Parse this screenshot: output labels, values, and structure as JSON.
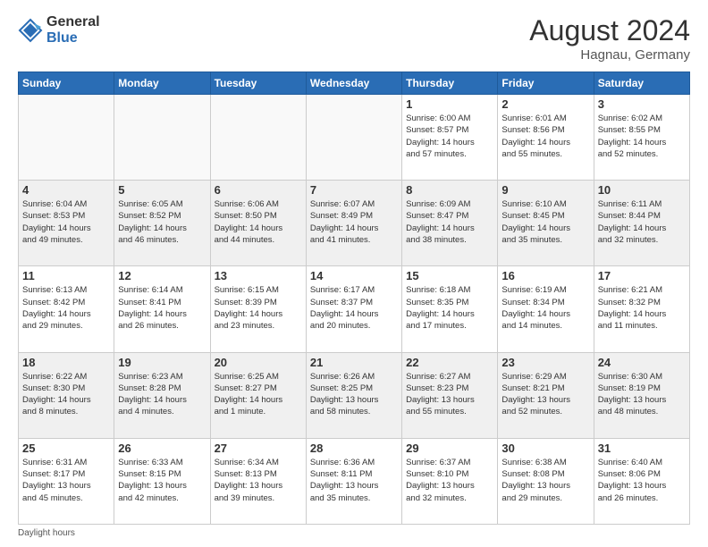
{
  "logo": {
    "general": "General",
    "blue": "Blue"
  },
  "header": {
    "month": "August 2024",
    "location": "Hagnau, Germany"
  },
  "days_of_week": [
    "Sunday",
    "Monday",
    "Tuesday",
    "Wednesday",
    "Thursday",
    "Friday",
    "Saturday"
  ],
  "footer": {
    "note": "Daylight hours"
  },
  "weeks": [
    {
      "days": [
        {
          "num": "",
          "empty": true
        },
        {
          "num": "",
          "empty": true
        },
        {
          "num": "",
          "empty": true
        },
        {
          "num": "",
          "empty": true
        },
        {
          "num": "1",
          "info": "Sunrise: 6:00 AM\nSunset: 8:57 PM\nDaylight: 14 hours\nand 57 minutes."
        },
        {
          "num": "2",
          "info": "Sunrise: 6:01 AM\nSunset: 8:56 PM\nDaylight: 14 hours\nand 55 minutes."
        },
        {
          "num": "3",
          "info": "Sunrise: 6:02 AM\nSunset: 8:55 PM\nDaylight: 14 hours\nand 52 minutes."
        }
      ]
    },
    {
      "days": [
        {
          "num": "4",
          "info": "Sunrise: 6:04 AM\nSunset: 8:53 PM\nDaylight: 14 hours\nand 49 minutes."
        },
        {
          "num": "5",
          "info": "Sunrise: 6:05 AM\nSunset: 8:52 PM\nDaylight: 14 hours\nand 46 minutes."
        },
        {
          "num": "6",
          "info": "Sunrise: 6:06 AM\nSunset: 8:50 PM\nDaylight: 14 hours\nand 44 minutes."
        },
        {
          "num": "7",
          "info": "Sunrise: 6:07 AM\nSunset: 8:49 PM\nDaylight: 14 hours\nand 41 minutes."
        },
        {
          "num": "8",
          "info": "Sunrise: 6:09 AM\nSunset: 8:47 PM\nDaylight: 14 hours\nand 38 minutes."
        },
        {
          "num": "9",
          "info": "Sunrise: 6:10 AM\nSunset: 8:45 PM\nDaylight: 14 hours\nand 35 minutes."
        },
        {
          "num": "10",
          "info": "Sunrise: 6:11 AM\nSunset: 8:44 PM\nDaylight: 14 hours\nand 32 minutes."
        }
      ]
    },
    {
      "days": [
        {
          "num": "11",
          "info": "Sunrise: 6:13 AM\nSunset: 8:42 PM\nDaylight: 14 hours\nand 29 minutes."
        },
        {
          "num": "12",
          "info": "Sunrise: 6:14 AM\nSunset: 8:41 PM\nDaylight: 14 hours\nand 26 minutes."
        },
        {
          "num": "13",
          "info": "Sunrise: 6:15 AM\nSunset: 8:39 PM\nDaylight: 14 hours\nand 23 minutes."
        },
        {
          "num": "14",
          "info": "Sunrise: 6:17 AM\nSunset: 8:37 PM\nDaylight: 14 hours\nand 20 minutes."
        },
        {
          "num": "15",
          "info": "Sunrise: 6:18 AM\nSunset: 8:35 PM\nDaylight: 14 hours\nand 17 minutes."
        },
        {
          "num": "16",
          "info": "Sunrise: 6:19 AM\nSunset: 8:34 PM\nDaylight: 14 hours\nand 14 minutes."
        },
        {
          "num": "17",
          "info": "Sunrise: 6:21 AM\nSunset: 8:32 PM\nDaylight: 14 hours\nand 11 minutes."
        }
      ]
    },
    {
      "days": [
        {
          "num": "18",
          "info": "Sunrise: 6:22 AM\nSunset: 8:30 PM\nDaylight: 14 hours\nand 8 minutes."
        },
        {
          "num": "19",
          "info": "Sunrise: 6:23 AM\nSunset: 8:28 PM\nDaylight: 14 hours\nand 4 minutes."
        },
        {
          "num": "20",
          "info": "Sunrise: 6:25 AM\nSunset: 8:27 PM\nDaylight: 14 hours\nand 1 minute."
        },
        {
          "num": "21",
          "info": "Sunrise: 6:26 AM\nSunset: 8:25 PM\nDaylight: 13 hours\nand 58 minutes."
        },
        {
          "num": "22",
          "info": "Sunrise: 6:27 AM\nSunset: 8:23 PM\nDaylight: 13 hours\nand 55 minutes."
        },
        {
          "num": "23",
          "info": "Sunrise: 6:29 AM\nSunset: 8:21 PM\nDaylight: 13 hours\nand 52 minutes."
        },
        {
          "num": "24",
          "info": "Sunrise: 6:30 AM\nSunset: 8:19 PM\nDaylight: 13 hours\nand 48 minutes."
        }
      ]
    },
    {
      "days": [
        {
          "num": "25",
          "info": "Sunrise: 6:31 AM\nSunset: 8:17 PM\nDaylight: 13 hours\nand 45 minutes."
        },
        {
          "num": "26",
          "info": "Sunrise: 6:33 AM\nSunset: 8:15 PM\nDaylight: 13 hours\nand 42 minutes."
        },
        {
          "num": "27",
          "info": "Sunrise: 6:34 AM\nSunset: 8:13 PM\nDaylight: 13 hours\nand 39 minutes."
        },
        {
          "num": "28",
          "info": "Sunrise: 6:36 AM\nSunset: 8:11 PM\nDaylight: 13 hours\nand 35 minutes."
        },
        {
          "num": "29",
          "info": "Sunrise: 6:37 AM\nSunset: 8:10 PM\nDaylight: 13 hours\nand 32 minutes."
        },
        {
          "num": "30",
          "info": "Sunrise: 6:38 AM\nSunset: 8:08 PM\nDaylight: 13 hours\nand 29 minutes."
        },
        {
          "num": "31",
          "info": "Sunrise: 6:40 AM\nSunset: 8:06 PM\nDaylight: 13 hours\nand 26 minutes."
        }
      ]
    }
  ]
}
